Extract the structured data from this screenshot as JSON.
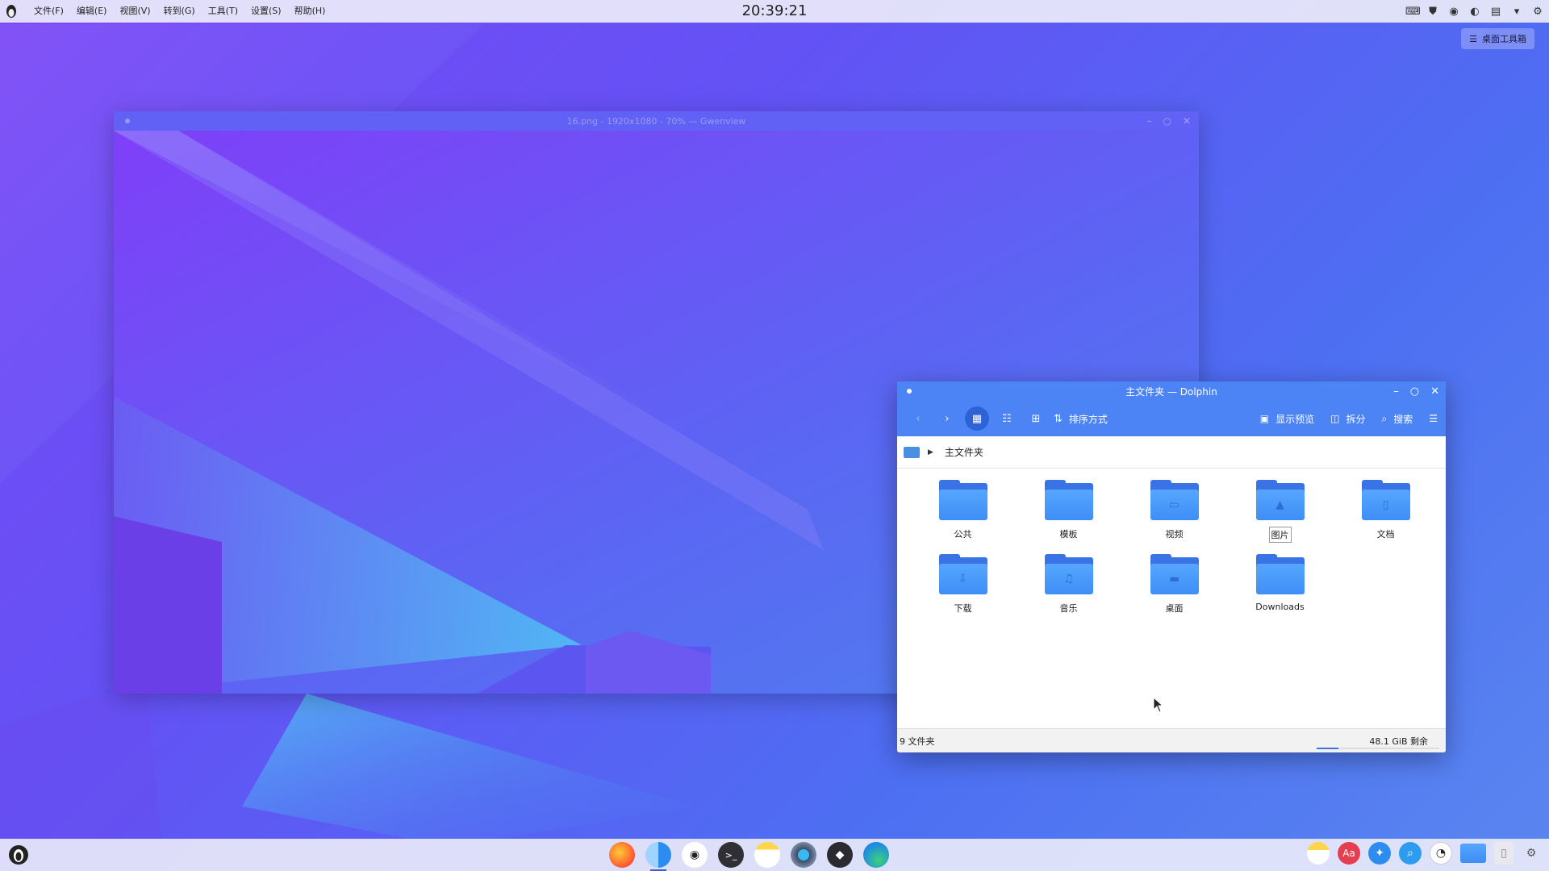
{
  "topbar": {
    "menu": [
      "文件(F)",
      "编辑(E)",
      "视图(V)",
      "转到(G)",
      "工具(T)",
      "设置(S)",
      "帮助(H)"
    ],
    "clock": "20:39:21",
    "tray_icons": [
      "keyboard-icon",
      "shield-icon",
      "network-icon",
      "volume-icon",
      "clipboard-icon",
      "dropdown-icon",
      "settings-icon"
    ]
  },
  "desktop": {
    "toolbox_label": "桌面工具箱"
  },
  "gwenview": {
    "title": "16.png - 1920x1080 - 70% — Gwenview"
  },
  "dolphin": {
    "title": "主文件夹 — Dolphin",
    "toolbar": {
      "sort_label": "排序方式",
      "preview_label": "显示预览",
      "split_label": "拆分",
      "search_label": "搜索"
    },
    "breadcrumb": "主文件夹",
    "folders": [
      {
        "name": "公共",
        "icon": ""
      },
      {
        "name": "模板",
        "icon": ""
      },
      {
        "name": "视频",
        "icon": "▭"
      },
      {
        "name": "图片",
        "icon": "▲",
        "selected": true
      },
      {
        "name": "文档",
        "icon": "▯"
      },
      {
        "name": "下载",
        "icon": "⇩"
      },
      {
        "name": "音乐",
        "icon": "♫"
      },
      {
        "name": "桌面",
        "icon": "▬"
      },
      {
        "name": "Downloads",
        "icon": ""
      }
    ],
    "status": {
      "count": "9 文件夹",
      "free_space": "48.1 GiB 剩余",
      "disk_used_fraction": 0.18
    }
  },
  "dock": {
    "apps": [
      "firefox-icon",
      "finder-icon",
      "github-icon",
      "terminal-icon",
      "notes-icon",
      "camera-icon",
      "inkscape-icon",
      "edge-icon"
    ],
    "right_apps": [
      "notes-icon",
      "dictionary-icon",
      "safari-icon",
      "search-icon",
      "clock-icon",
      "folder-icon",
      "trash-icon",
      "settings-icon"
    ],
    "dictionary_label": "Aa"
  }
}
